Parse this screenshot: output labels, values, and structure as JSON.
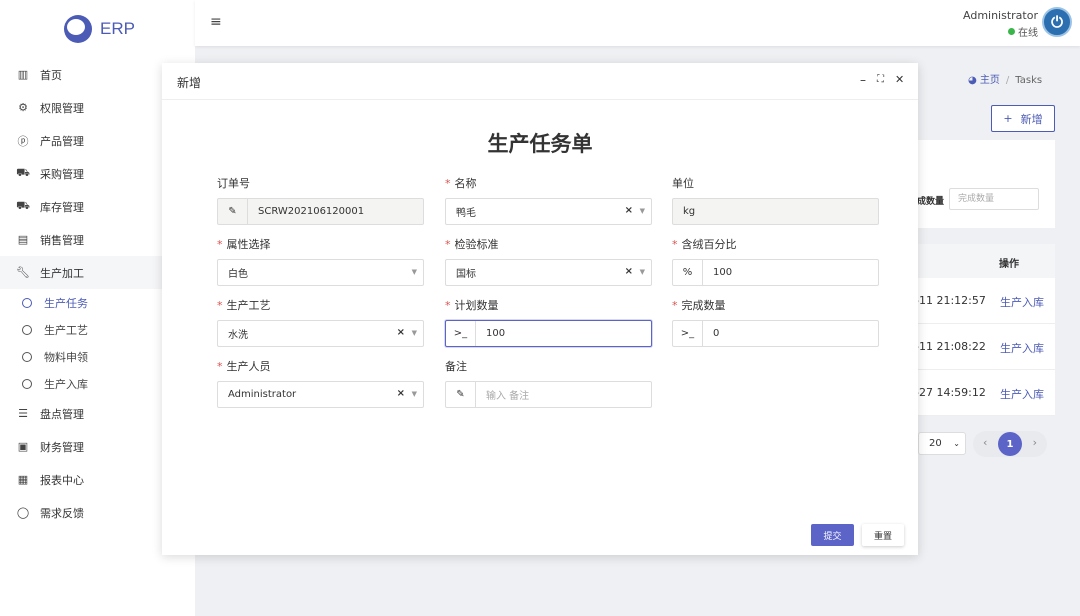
{
  "app": {
    "logo_text": "ERP"
  },
  "sidebar": {
    "items": [
      {
        "label": "首页",
        "icon": "bar-chart-icon"
      },
      {
        "label": "权限管理",
        "icon": "gear-icon"
      },
      {
        "label": "产品管理",
        "icon": "p-circle-icon"
      },
      {
        "label": "采购管理",
        "icon": "cart-icon"
      },
      {
        "label": "库存管理",
        "icon": "truck-icon"
      },
      {
        "label": "销售管理",
        "icon": "calendar-icon"
      },
      {
        "label": "生产加工",
        "icon": "wrench-icon"
      }
    ],
    "sub_items": [
      {
        "label": "生产任务"
      },
      {
        "label": "生产工艺"
      },
      {
        "label": "物料申领"
      },
      {
        "label": "生产入库"
      }
    ],
    "items_after": [
      {
        "label": "盘点管理",
        "icon": "database-icon"
      },
      {
        "label": "财务管理",
        "icon": "money-icon"
      },
      {
        "label": "报表中心",
        "icon": "calendar-grid-icon"
      },
      {
        "label": "需求反馈",
        "icon": "chat-icon"
      }
    ]
  },
  "header": {
    "menu_glyph": "≡",
    "user_name": "Administrator",
    "user_status": "在线",
    "avatar_glyph": "⏻"
  },
  "breadcrumb": {
    "home": "主页",
    "sep": "/",
    "current": "Tasks"
  },
  "page": {
    "new_button": "新增",
    "filter_label": "成数量",
    "filter_placeholder": "完成数量",
    "table": {
      "op_header": "操作",
      "rows": [
        {
          "time": "-11 21:12:57",
          "action": "生产入库"
        },
        {
          "time": "-11 21:08:22",
          "action": "生产入库"
        },
        {
          "time": "-27 14:59:12",
          "action": "生产入库"
        }
      ]
    },
    "pagination": {
      "page_size": "20",
      "current": "1",
      "prev": "‹",
      "next": "›",
      "size_caret": "⌄"
    }
  },
  "modal": {
    "title": "新增",
    "minimize": "–",
    "maximize": "⛶",
    "close": "✕",
    "form_title": "生产任务单",
    "fields": {
      "order_no": {
        "label": "订单号",
        "value": "SCRW202106120001",
        "prefix": "✎"
      },
      "name": {
        "label": "名称",
        "value": "鸭毛",
        "required": "*"
      },
      "unit": {
        "label": "单位",
        "value": "kg"
      },
      "attribute": {
        "label": "属性选择",
        "value": "白色",
        "required": "*"
      },
      "standard": {
        "label": "检验标准",
        "value": "国标",
        "required": "*"
      },
      "down_pct": {
        "label": "含绒百分比",
        "value": "100",
        "prefix": "%",
        "required": "*"
      },
      "process": {
        "label": "生产工艺",
        "value": "水洗",
        "required": "*"
      },
      "plan_qty": {
        "label": "计划数量",
        "value": "100",
        "prefix": ">_",
        "required": "*"
      },
      "done_qty": {
        "label": "完成数量",
        "value": "0",
        "prefix": ">_",
        "required": "*"
      },
      "staff": {
        "label": "生产人员",
        "value": "Administrator",
        "required": "*"
      },
      "remark": {
        "label": "备注",
        "placeholder": "输入 备注",
        "prefix": "✎"
      }
    },
    "clear_glyph": "×",
    "caret_glyph": "▼",
    "submit": "提交",
    "reset": "重置"
  }
}
